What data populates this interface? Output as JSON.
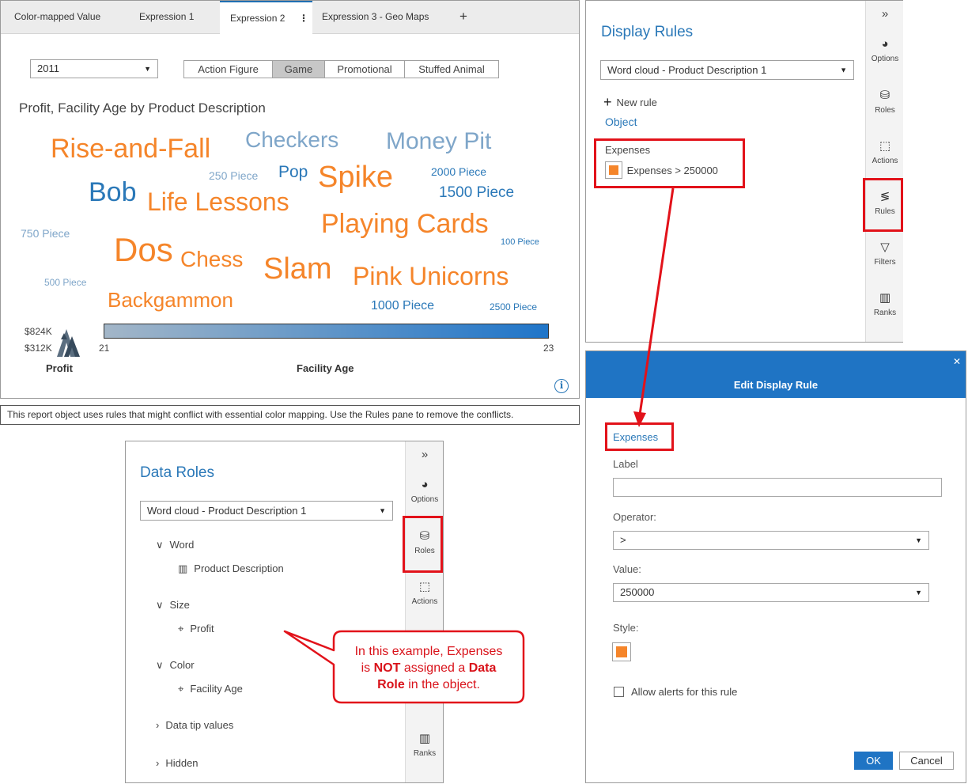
{
  "report": {
    "tabs": [
      "Color-mapped Value",
      "Expression 1",
      "Expression 2",
      "Expression 3 - Geo Maps"
    ],
    "add_tab": "+",
    "tab_menu": "⋮",
    "year": "2011",
    "buttons": [
      "Action Figure",
      "Game",
      "Promotional",
      "Stuffed Animal"
    ],
    "selected_button": "Game",
    "chart_title": "Profit, Facility Age by Product Description",
    "words": [
      "Rise-and-Fall",
      "Checkers",
      "Money Pit",
      "250 Piece",
      "Pop",
      "Spike",
      "2000 Piece",
      "Bob",
      "Life Lessons",
      "1500 Piece",
      "Playing Cards",
      "750 Piece",
      "100 Piece",
      "Dos",
      "Chess",
      "Slam",
      "Pink Unicorns",
      "500 Piece",
      "Backgammon",
      "1000 Piece",
      "2500 Piece"
    ],
    "legend": {
      "size_max": "$824K",
      "size_min": "$312K",
      "size_label": "Profit",
      "color_min": "21",
      "color_max": "23",
      "color_label": "Facility Age"
    },
    "warning": "This report object uses rules that might conflict with essential color mapping. Use the Rules pane to remove the conflicts."
  },
  "display_rules": {
    "title": "Display Rules",
    "object_select": "Word cloud - Product Description 1",
    "new_rule": "New rule",
    "object_link": "Object",
    "rule_group": "Expenses",
    "rule_item": "Expenses > 250000"
  },
  "sidebar": {
    "collapse": "»",
    "items": [
      "Options",
      "Roles",
      "Actions",
      "Rules",
      "Filters",
      "Ranks"
    ]
  },
  "edit_rule": {
    "title": "Edit Display Rule",
    "close": "✕",
    "link": "Expenses",
    "label_label": "Label",
    "label_value": "",
    "operator_label": "Operator:",
    "operator_value": ">",
    "value_label": "Value:",
    "value_value": "250000",
    "style_label": "Style:",
    "alerts_label": "Allow alerts for this rule",
    "ok": "OK",
    "cancel": "Cancel"
  },
  "data_roles": {
    "title": "Data Roles",
    "object_select": "Word cloud - Product Description 1",
    "groups": {
      "word": "Word",
      "word_item": "Product Description",
      "size": "Size",
      "size_item": "Profit",
      "color": "Color",
      "color_item": "Facility Age",
      "datatip": "Data tip values",
      "hidden": "Hidden"
    }
  },
  "callout": {
    "line1": "In this example, Expenses",
    "line2_pre": "is ",
    "line2_bold": "NOT",
    "line2_mid": " assigned a ",
    "line2_bold2": "Data",
    "line3_bold": "Role",
    "line3_post": " in the object."
  },
  "colors": {
    "orange": "#f5852a",
    "blue": "#2a78b8",
    "light_blue": "#7fa6c9",
    "red": "#e2121a"
  }
}
